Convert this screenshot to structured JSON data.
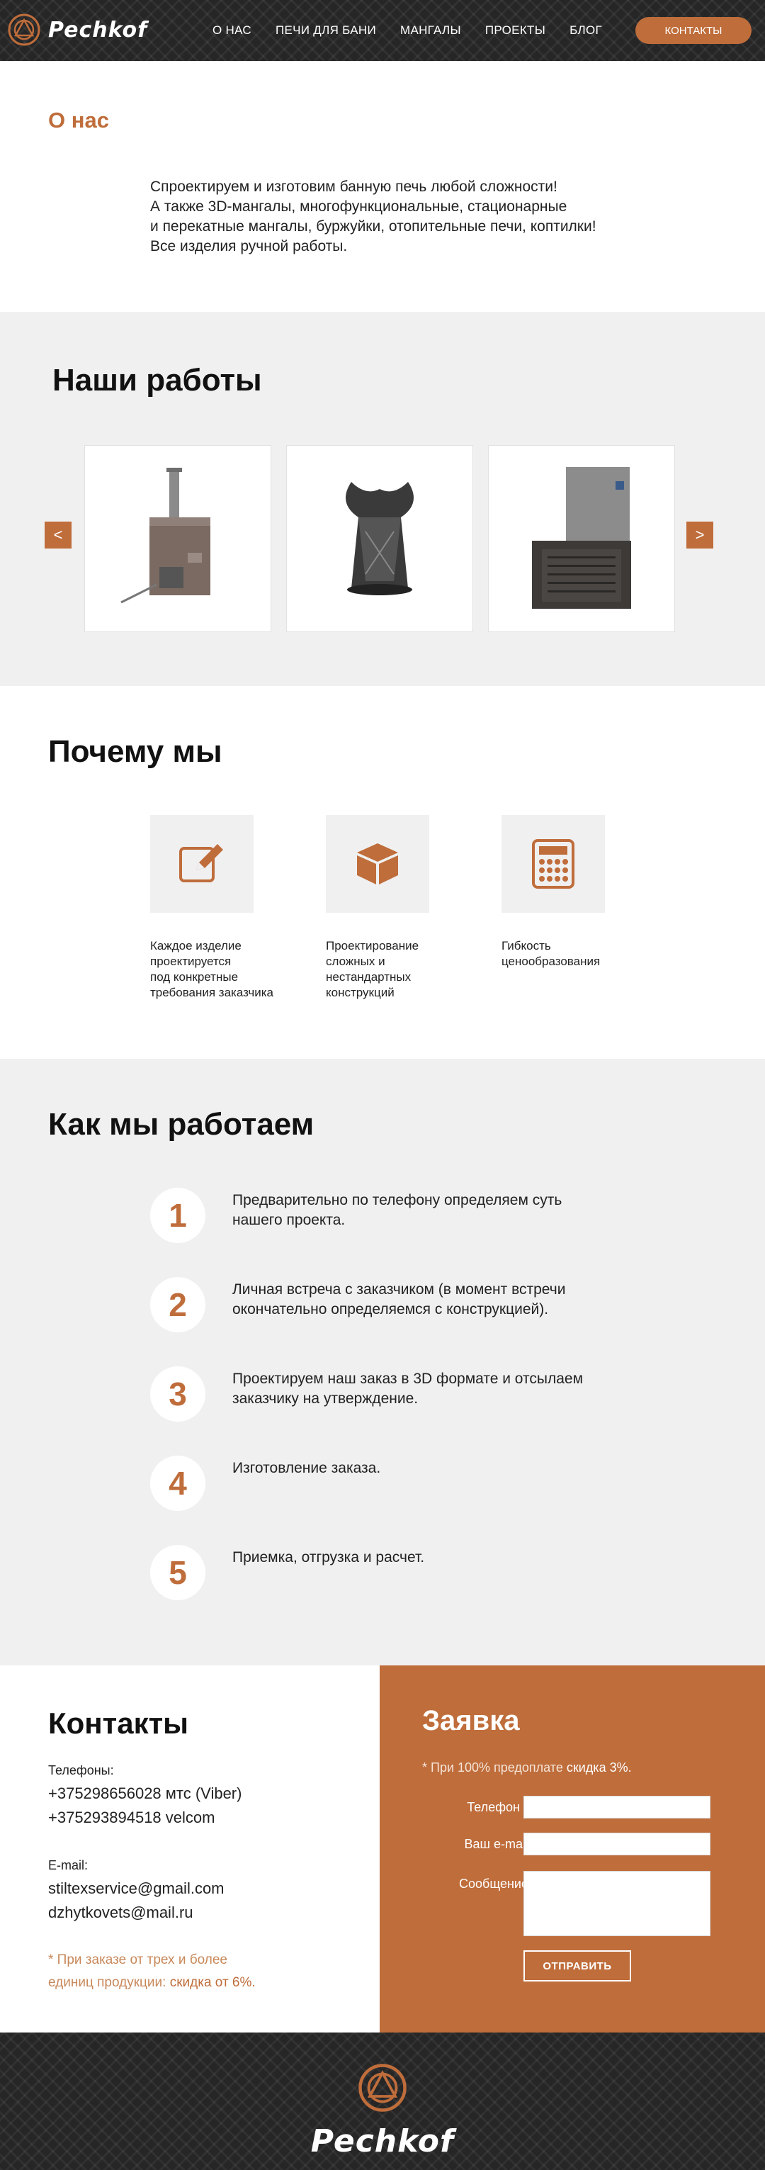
{
  "brand": {
    "name": "Pechkof",
    "accent": "#bf6d3b"
  },
  "nav": {
    "items": [
      "О нас",
      "Печи для бани",
      "Мангалы",
      "Проекты",
      "Блог"
    ],
    "cta": "Контакты"
  },
  "about": {
    "title": "О нас",
    "lines": [
      "Спроектируем и изготовим банную печь любой сложности!",
      "А также 3D-мангалы, многофункциональные, стационарные",
      "и перекатные мангалы, буржуйки, отопительные печи, коптилки!",
      "Все изделия ручной работы."
    ]
  },
  "works": {
    "title": "Наши работы",
    "prev": "<",
    "next": ">"
  },
  "why": {
    "title": "Почему мы",
    "items": [
      {
        "icon": "edit-icon",
        "text": [
          "Каждое изделие",
          "проектируется",
          "под конкретные",
          "требования заказчика"
        ]
      },
      {
        "icon": "cube-icon",
        "text": [
          "Проектирование",
          "сложных и",
          "нестандартных",
          "конструкций"
        ]
      },
      {
        "icon": "calculator-icon",
        "text": [
          "Гибкость",
          "ценообразования"
        ]
      }
    ]
  },
  "how": {
    "title": "Как мы работаем",
    "steps": [
      {
        "num": "1",
        "text": [
          "Предварительно по телефону определяем суть",
          "нашего проекта."
        ]
      },
      {
        "num": "2",
        "text": [
          "Личная встреча с заказчиком (в момент встречи",
          "окончательно определяемся с конструкцией)."
        ]
      },
      {
        "num": "3",
        "text": [
          "Проектируем наш заказ в 3D формате и отсылаем",
          "заказчику на утверждение."
        ]
      },
      {
        "num": "4",
        "text": [
          "Изготовление заказа."
        ]
      },
      {
        "num": "5",
        "text": [
          "Приемка, отгрузка и расчет."
        ]
      }
    ]
  },
  "contacts": {
    "title": "Контакты",
    "phones_label": "Телефоны:",
    "phones": [
      "+375298656028 мтс (Viber)",
      "+375293894518 velcom"
    ],
    "email_label": "E-mail:",
    "emails": [
      "stiltexservice@gmail.com",
      "dzhytkovets@mail.ru"
    ],
    "note_line1": "* При заказе от трех и более",
    "note_line2": "единиц продукции:",
    "note_highlight": "скидка от 6%."
  },
  "order": {
    "title": "Заявка",
    "note": "* При 100% предоплате",
    "note_highlight": "скидка 3%.",
    "phone_label": "Телефон *",
    "email_label": "Ваш e-mail",
    "message_label": "Сообщение",
    "submit": "Отправить"
  }
}
